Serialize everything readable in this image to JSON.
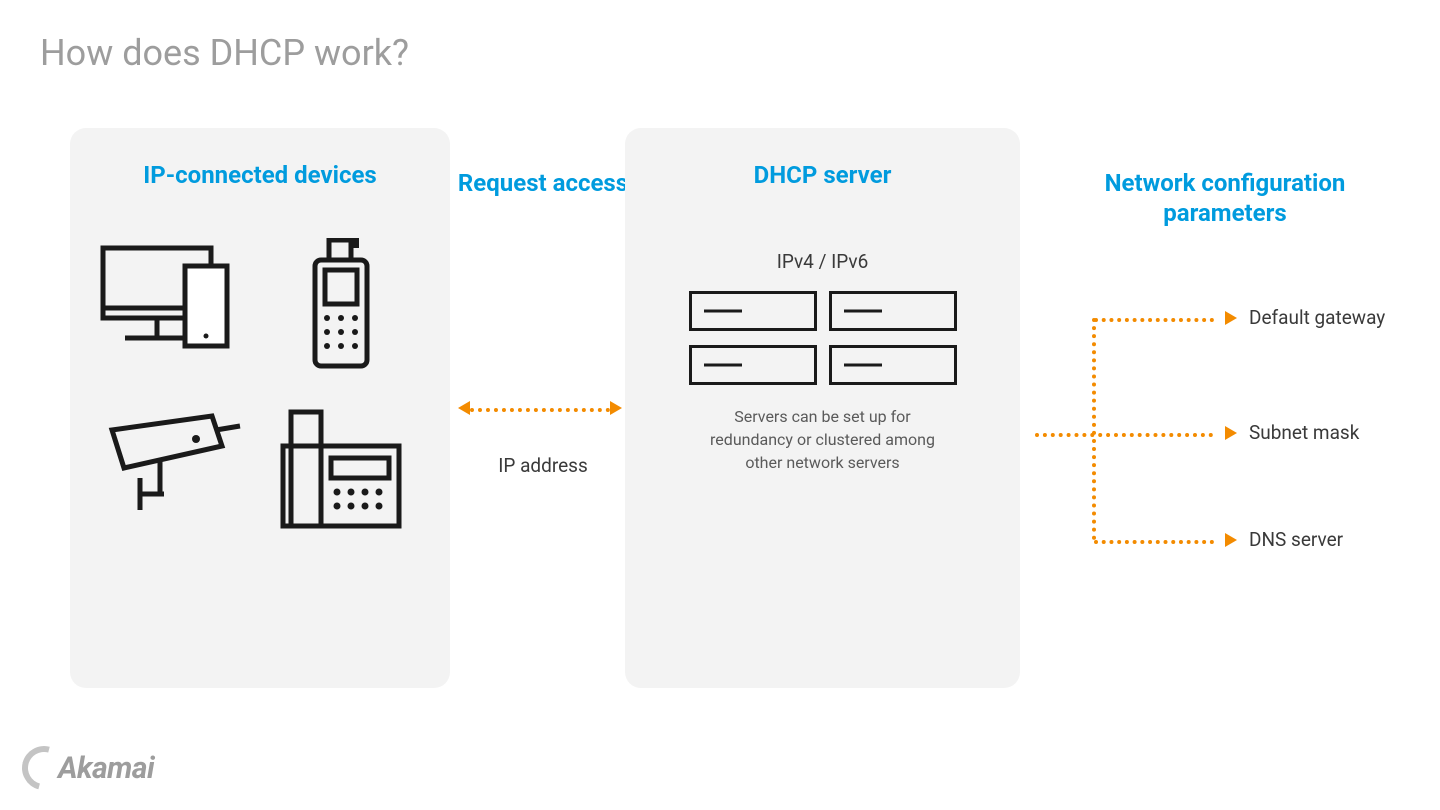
{
  "title": "How does DHCP work?",
  "devices": {
    "heading": "IP-connected devices"
  },
  "request": {
    "heading": "Request access",
    "sub": "IP address"
  },
  "server": {
    "heading": "DHCP server",
    "ipversion": "IPv4 / IPv6",
    "desc": "Servers can be set up for redundancy or clustered among other network servers"
  },
  "params": {
    "heading": "Network configuration parameters",
    "items": [
      "Default gateway",
      "Subnet mask",
      "DNS server"
    ]
  },
  "brand": "Akamai",
  "colors": {
    "accent_blue": "#009bde",
    "accent_orange": "#f38b00"
  }
}
